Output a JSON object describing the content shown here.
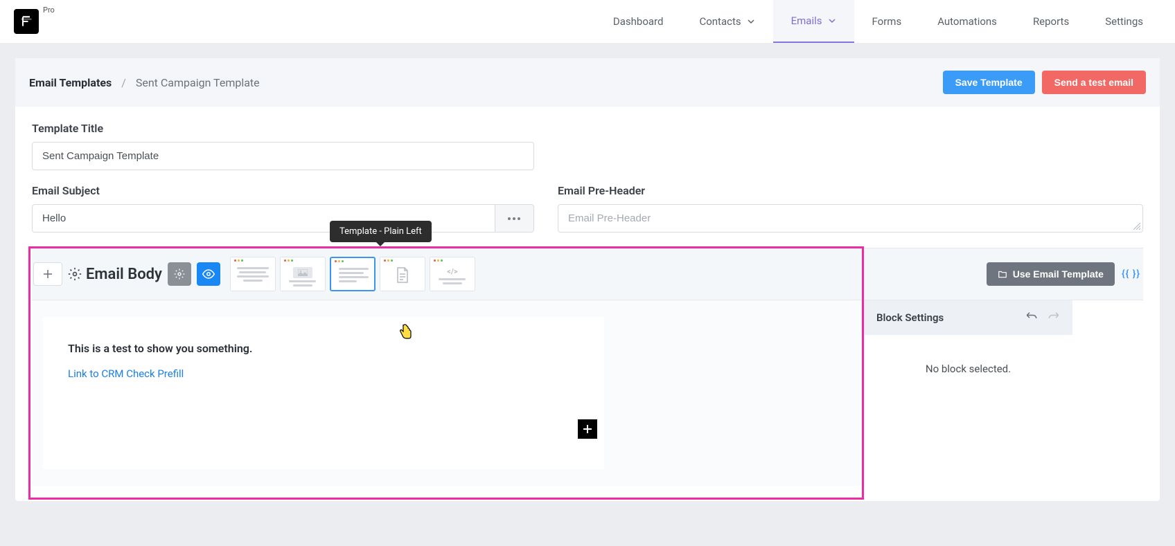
{
  "header": {
    "pro_label": "Pro",
    "nav": {
      "dashboard": "Dashboard",
      "contacts": "Contacts",
      "emails": "Emails",
      "forms": "Forms",
      "automations": "Automations",
      "reports": "Reports",
      "settings": "Settings"
    }
  },
  "page": {
    "breadcrumb_main": "Email Templates",
    "breadcrumb_sep": "/",
    "breadcrumb_sub": "Sent Campaign Template",
    "save_button": "Save Template",
    "test_button": "Send a test email"
  },
  "form": {
    "title_label": "Template Title",
    "title_value": "Sent Campaign Template",
    "subject_label": "Email Subject",
    "subject_value": "Hello",
    "preheader_label": "Email Pre-Header",
    "preheader_placeholder": "Email Pre-Header"
  },
  "editor": {
    "body_title": "Email Body",
    "tooltip": "Template - Plain Left",
    "use_template_button": "Use Email Template",
    "braces": "{{ }}",
    "canvas_text": "This is a test to show you something.",
    "canvas_link": "Link to CRM Check Prefill"
  },
  "sidebar": {
    "title": "Block Settings",
    "empty_text": "No block selected."
  }
}
